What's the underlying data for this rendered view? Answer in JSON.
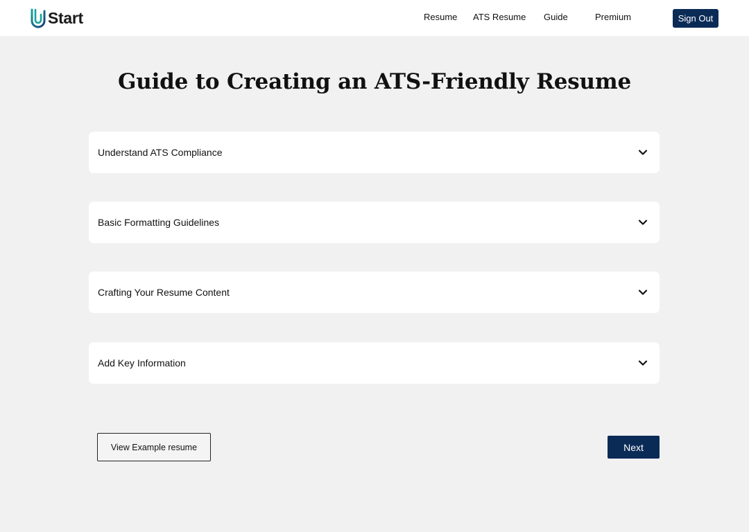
{
  "brand": {
    "logo_icon": "paperclip-u-icon",
    "name": "Start",
    "accent_colors": [
      "#0f8f8c",
      "#1a3a6e"
    ]
  },
  "nav": {
    "links": [
      "Resume",
      "ATS Resume",
      "Guide",
      "Premium"
    ],
    "sign_out_label": "Sign Out"
  },
  "main": {
    "title": "Guide to Creating an ATS-Friendly Resume",
    "sections": [
      {
        "label": "Understand ATS Compliance",
        "expanded": false,
        "icon": "chevron-down-icon"
      },
      {
        "label": "Basic Formatting Guidelines",
        "expanded": false,
        "icon": "chevron-down-icon"
      },
      {
        "label": "Crafting Your Resume Content",
        "expanded": false,
        "icon": "chevron-down-icon"
      },
      {
        "label": "Add Key Information",
        "expanded": false,
        "icon": "chevron-down-icon"
      }
    ],
    "example_button_label": "View Example resume",
    "next_button_label": "Next"
  },
  "colors": {
    "primary_button": "#0b2b57",
    "background": "#f1f1f1",
    "card": "#ffffff"
  }
}
